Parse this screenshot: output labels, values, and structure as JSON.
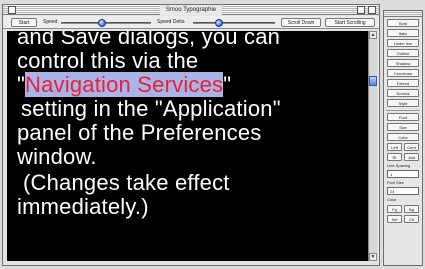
{
  "window": {
    "title": "Smoo Typographie"
  },
  "toolbar": {
    "start_label": "Start",
    "speed_label": "Speed",
    "speed_value": 0.45,
    "speed_delta_label": "Speed Delta",
    "speed_delta_value": 0.3,
    "btn_right_1": "Scroll Down",
    "btn_right_2": "Start Scrolling"
  },
  "document": {
    "lines": [
      "and Save dialogs, you can",
      "control this via the",
      "\"",
      "Navigation Services",
      "\"",
      "setting in the \"Application\"",
      "panel of the Preferences",
      "window.",
      "(Changes take effect",
      "immediately.)"
    ]
  },
  "scrollbar": {
    "up_glyph": "▲",
    "down_glyph": "▼",
    "position": 0.18
  },
  "palette": {
    "buttons_top": [
      "Bold",
      "Italic",
      "Under line",
      "Outline",
      "Shadow",
      "Condense",
      "Extend",
      "Normal",
      "Style"
    ],
    "buttons_mid": [
      "Font",
      "Size",
      "Color"
    ],
    "row_1": [
      "Left",
      "Cent"
    ],
    "row_2": [
      "Rt",
      "Just"
    ],
    "label_line_spacing": "Line Spacing",
    "field_line_spacing": "1",
    "label_font_size": "Font Size",
    "field_font_size": "24",
    "label_color": "Color",
    "row_3": [
      "Fg",
      "Bg"
    ],
    "row_4": [
      "Set",
      "Clr"
    ]
  },
  "colors": {
    "text": "#ffffff",
    "background": "#000000",
    "highlight_text": "#e8213a",
    "highlight_bg": "#aab4e6"
  }
}
